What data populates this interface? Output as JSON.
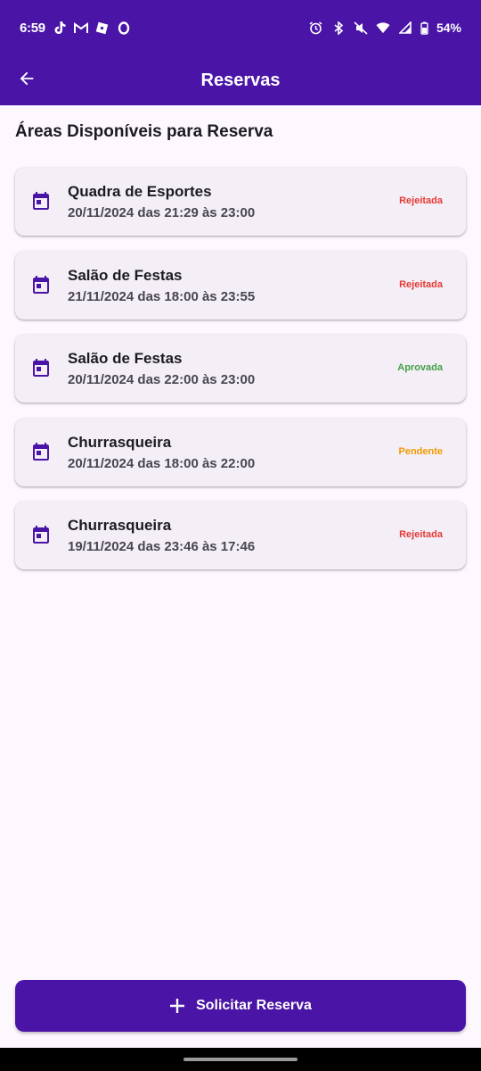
{
  "status_bar": {
    "time": "6:59",
    "battery": "54%",
    "left_icons": [
      "tiktok-icon",
      "gmail-icon",
      "roblox-icon",
      "circle-app-icon"
    ],
    "right_icons": [
      "alarm-icon",
      "bluetooth-icon",
      "mute-icon",
      "wifi-icon",
      "signal-icon",
      "battery-icon"
    ]
  },
  "header": {
    "title": "Reservas",
    "back_icon": "arrow-back-icon"
  },
  "section": {
    "title": "Áreas Disponíveis para Reserva"
  },
  "reservations": [
    {
      "area": "Quadra de Esportes",
      "schedule": "20/11/2024 das 21:29 às 23:00",
      "status": "Rejeitada",
      "status_color": "#e53935"
    },
    {
      "area": "Salão de Festas",
      "schedule": "21/11/2024 das 18:00 às 23:55",
      "status": "Rejeitada",
      "status_color": "#e53935"
    },
    {
      "area": "Salão de Festas",
      "schedule": "20/11/2024 das 22:00 às 23:00",
      "status": "Aprovada",
      "status_color": "#43a047"
    },
    {
      "area": "Churrasqueira",
      "schedule": "20/11/2024 das 18:00 às 22:00",
      "status": "Pendente",
      "status_color": "#f29900"
    },
    {
      "area": "Churrasqueira",
      "schedule": "19/11/2024 das 23:46 às 17:46",
      "status": "Rejeitada",
      "status_color": "#e53935"
    }
  ],
  "action": {
    "label": "Solicitar Reserva",
    "icon": "plus-icon"
  },
  "colors": {
    "primary": "#4a14a6",
    "background": "#fdf7fe",
    "card": "#f4eff6",
    "icon": "#4a14a6"
  }
}
